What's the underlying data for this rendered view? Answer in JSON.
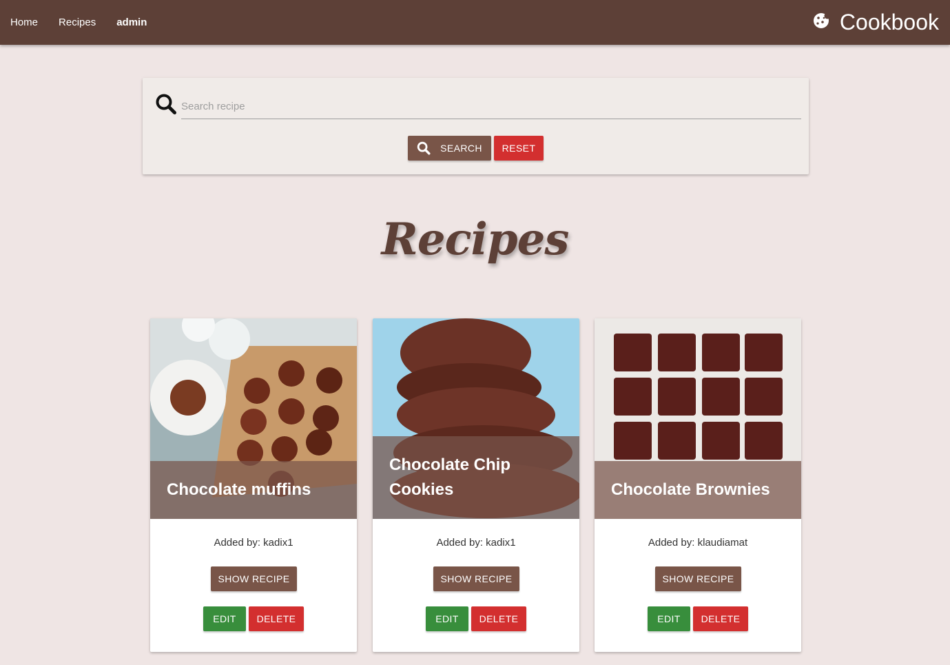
{
  "nav": {
    "links": [
      "Home",
      "Recipes",
      "admin"
    ],
    "brand": "Cookbook",
    "brand_icon": "cookie-icon"
  },
  "search": {
    "placeholder": "Search recipe",
    "value": "",
    "search_label": "SEARCH",
    "reset_label": "RESET"
  },
  "page": {
    "title": "Recipes"
  },
  "recipes": [
    {
      "title": "Chocolate muffins",
      "author": "Added by: kadix1",
      "show_label": "SHOW RECIPE",
      "edit_label": "EDIT",
      "delete_label": "DELETE"
    },
    {
      "title": "Chocolate Chip Cookies",
      "author": "Added by: kadix1",
      "show_label": "SHOW RECIPE",
      "edit_label": "EDIT",
      "delete_label": "DELETE"
    },
    {
      "title": "Chocolate Brownies",
      "author": "Added by: klaudiamat",
      "show_label": "SHOW RECIPE",
      "edit_label": "EDIT",
      "delete_label": "DELETE"
    }
  ],
  "colors": {
    "navbar": "#5d4037",
    "background": "#efe5e4",
    "brown_button": "#795548",
    "red_button": "#d32f2f",
    "green_button": "#388e3c"
  }
}
